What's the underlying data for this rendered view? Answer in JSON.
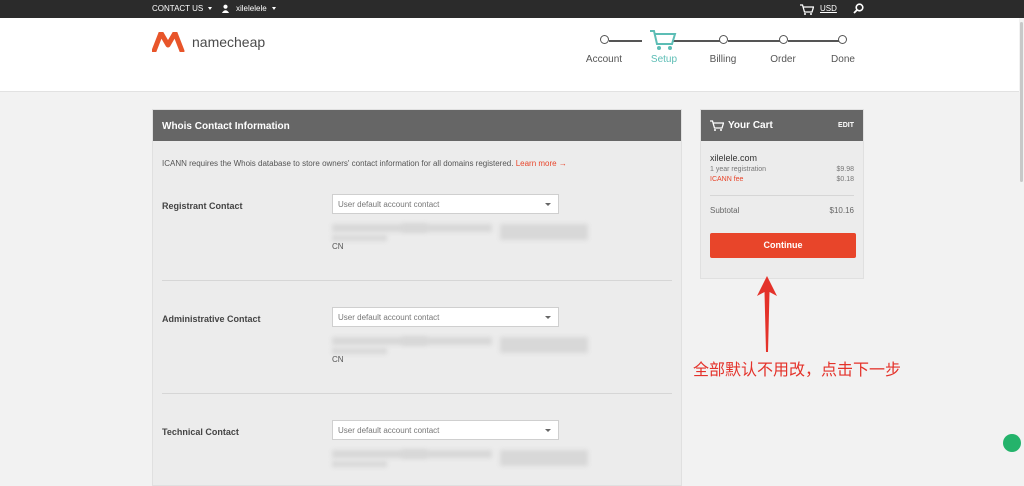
{
  "topbar": {
    "contact_label": "CONTACT US",
    "username": "xilelelele",
    "currency": "USD"
  },
  "header": {
    "logo_text": "namecheap",
    "steps": [
      {
        "label": "Account"
      },
      {
        "label": "Setup"
      },
      {
        "label": "Billing"
      },
      {
        "label": "Order"
      },
      {
        "label": "Done"
      }
    ],
    "active_step": "Setup"
  },
  "whois": {
    "title": "Whois Contact Information",
    "intro": "ICANN requires the Whois database to store owners' contact information for all domains registered.",
    "learn_more": "Learn more →",
    "contacts": [
      {
        "label": "Registrant Contact",
        "select_value": "User default account contact",
        "country": "CN"
      },
      {
        "label": "Administrative Contact",
        "select_value": "User default account contact",
        "country": "CN"
      },
      {
        "label": "Technical Contact",
        "select_value": "User default account contact",
        "country": ""
      }
    ]
  },
  "cart": {
    "title": "Your Cart",
    "edit": "EDIT",
    "domain": "xilelele.com",
    "items": [
      {
        "label": "1 year registration",
        "price": "$9.98"
      },
      {
        "label": "ICANN fee",
        "price": "$0.18"
      }
    ],
    "subtotal_label": "Subtotal",
    "subtotal_value": "$10.16",
    "continue_label": "Continue"
  },
  "annotation": {
    "text": "全部默认不用改，点击下一步"
  },
  "colors": {
    "accent": "#e8452a",
    "active_step": "#5cbdb5",
    "panel_header": "#666666",
    "annotation": "#e4322a"
  }
}
